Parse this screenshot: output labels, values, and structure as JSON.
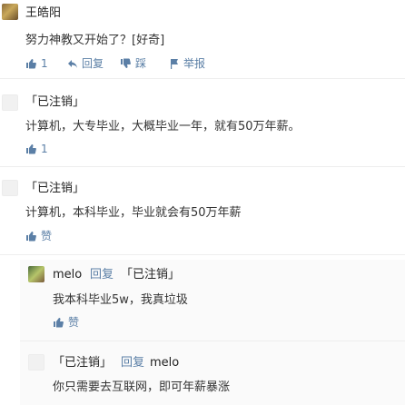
{
  "thread": {
    "top": {
      "author": "王皓阳",
      "text": "努力神教又开始了？[好奇]",
      "likes": "1",
      "reply_label": "回复",
      "dislike_label": "踩",
      "report_label": "举报"
    },
    "c1": {
      "author": "「已注销」",
      "text": "计算机，大专毕业，大概毕业一年，就有50万年薪。",
      "likes": "1"
    },
    "c2": {
      "author": "「已注销」",
      "text": "计算机，本科毕业，毕业就会有50万年薪",
      "likes": "赞"
    },
    "c3": {
      "author": "melo",
      "reply_word": "回复",
      "reply_to": "「已注销」",
      "text": "我本科毕业5w，我真垃圾",
      "likes": "赞"
    },
    "c4": {
      "author": "「已注销」",
      "reply_word": "回复",
      "reply_to": "melo",
      "text": "你只需要去互联网，即可年薪暴涨"
    }
  },
  "colors": {
    "link": "#2f5f9e",
    "meta": "#5b7fa6",
    "text": "#333333"
  }
}
